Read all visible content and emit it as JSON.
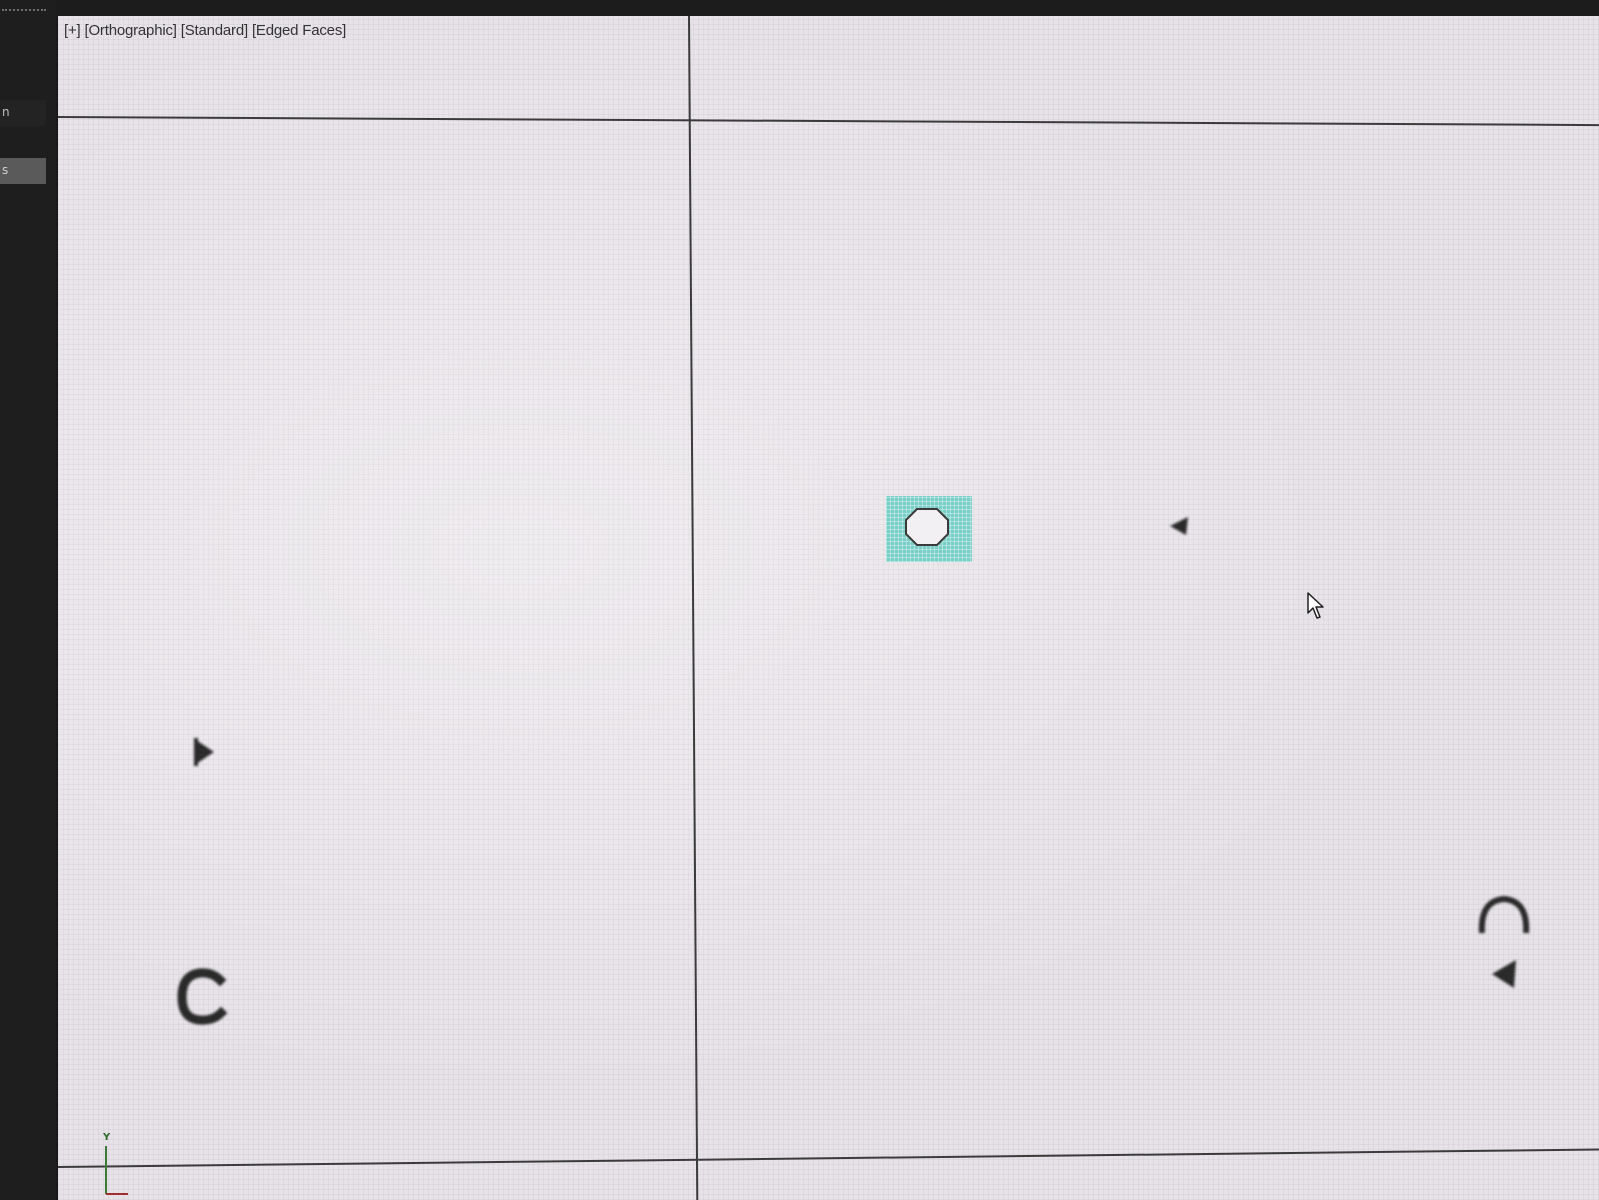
{
  "sidebar": {
    "items": [
      {
        "label": "n"
      },
      {
        "label": "s"
      }
    ]
  },
  "viewport": {
    "labels": {
      "plus": "[+]",
      "projection": "[Orthographic]",
      "shading": "[Standard]",
      "display": "[Edged Faces]"
    },
    "background_color": "#e7e2e8",
    "selection_color": "#79cfc7",
    "axis_gizmo": {
      "y_label": "Y"
    },
    "objects": [
      {
        "name": "selected-octagon-object",
        "icon": "octagon-icon"
      },
      {
        "name": "marker-triangle-left",
        "icon": "triangle-left-icon"
      },
      {
        "name": "marker-triangle-right",
        "icon": "triangle-right-icon"
      },
      {
        "name": "marker-c-glyph",
        "icon": "c-shape-icon"
      },
      {
        "name": "marker-arc",
        "icon": "arc-icon"
      },
      {
        "name": "marker-triangle-bottom-right",
        "icon": "triangle-left-icon"
      }
    ]
  }
}
